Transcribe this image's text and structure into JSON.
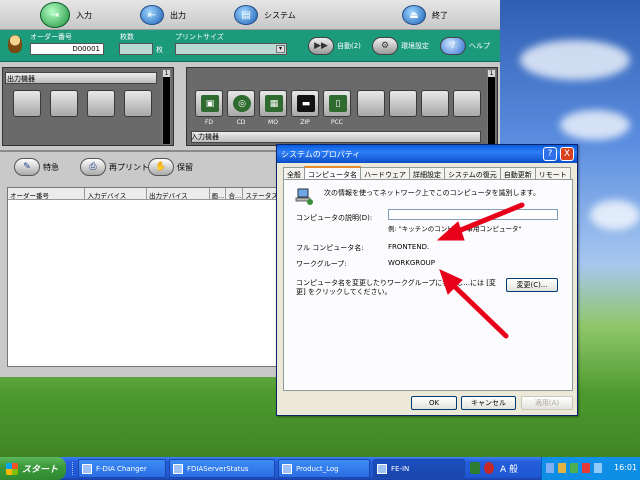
{
  "top_toolbar": {
    "input": "入力",
    "output": "出力",
    "system": "システム",
    "exit": "終了"
  },
  "order_bar": {
    "order_no_label": "オーダー番号",
    "order_no_value": "D00001",
    "count_label": "枚数",
    "count_unit": "枚",
    "print_size_label": "プリントサイズ",
    "auto_label": "自動(2)",
    "env_label": "環境設定",
    "help_label": "ヘルプ"
  },
  "output_panel": {
    "title": "出力機器",
    "slot_count": 4
  },
  "input_panel": {
    "title": "入力機器",
    "devices": [
      "FD",
      "CD",
      "MO",
      "ZIP",
      "PCC"
    ],
    "empty_slots": 4
  },
  "scroll_indicator": "1",
  "tool2": {
    "special": "特急",
    "reprint": "再プリント",
    "hold": "保留"
  },
  "order_table": {
    "columns": [
      "オーダー番号",
      "入力デバイス",
      "出力デバイス",
      "画...",
      "合...",
      "ステータス"
    ]
  },
  "dialog": {
    "title": "システムのプロパティ",
    "help_btn": "?",
    "close_btn": "X",
    "tabs": [
      "全般",
      "コンピュータ名",
      "ハードウェア",
      "詳細設定",
      "システムの復元",
      "自動更新",
      "リモート"
    ],
    "active_tab": "コンピュータ名",
    "info_text": "次の情報を使ってネットワーク上でこのコンピュータを識別します。",
    "description_label": "コンピュータの説明(D):",
    "description_value": "",
    "example_text": "例: \"キッチンのコンピュ...事用コンピュータ\"",
    "full_name_label": "フル コンピュータ名:",
    "full_name_value": "FRONTEND.",
    "workgroup_label": "ワークグループ:",
    "workgroup_value": "WORKGROUP",
    "rename_text_1": "コンピュータ名を変更したりワークグループに参加し...には [変",
    "rename_text_2": "更] をクリックしてください。",
    "change_button": "変更(C)...",
    "ok": "OK",
    "cancel": "キャンセル",
    "apply": "適用(A)"
  },
  "taskbar": {
    "start": "スタート",
    "items": [
      "F-DIA Changer",
      "FDIAServerStatus",
      "Product_Log",
      "FE-IN"
    ],
    "ime": "A 般",
    "clock": "16:01"
  },
  "colors": {
    "app_green": "#1c9a7c",
    "arrow_red": "#e8001a",
    "xp_blue": "#245edb"
  }
}
